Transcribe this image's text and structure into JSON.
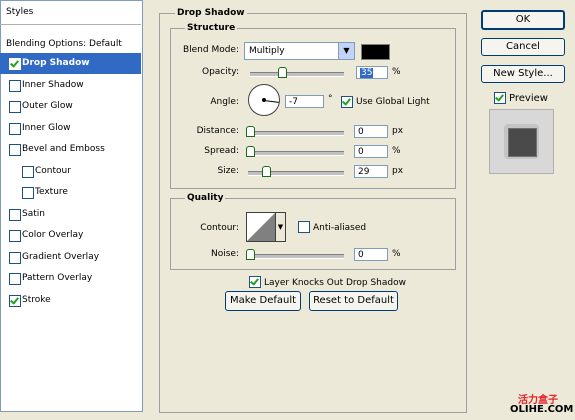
{
  "styles_panel": {
    "header": "Styles",
    "blending_options": "Blending Options: Default",
    "items": [
      {
        "label": "Drop Shadow",
        "checked": true
      },
      {
        "label": "Inner Shadow",
        "checked": false
      },
      {
        "label": "Outer Glow",
        "checked": false
      },
      {
        "label": "Inner Glow",
        "checked": false
      },
      {
        "label": "Bevel and Emboss",
        "checked": false
      },
      {
        "label": "Contour",
        "checked": false
      },
      {
        "label": "Texture",
        "checked": false
      },
      {
        "label": "Satin",
        "checked": false
      },
      {
        "label": "Color Overlay",
        "checked": false
      },
      {
        "label": "Gradient Overlay",
        "checked": false
      },
      {
        "label": "Pattern Overlay",
        "checked": false
      },
      {
        "label": "Stroke",
        "checked": true
      }
    ]
  },
  "drop_shadow": {
    "title": "Drop Shadow",
    "structure": {
      "title": "Structure",
      "blend_mode_label": "Blend Mode:",
      "blend_mode_value": "Multiply",
      "shadow_color": "#000000",
      "opacity_label": "Opacity:",
      "opacity_value": "35",
      "opacity_unit": "%",
      "angle_label": "Angle:",
      "angle_value": "-7",
      "angle_unit": "°",
      "use_global_light": "Use Global Light",
      "distance_label": "Distance:",
      "distance_value": "0",
      "distance_unit": "px",
      "spread_label": "Spread:",
      "spread_value": "0",
      "spread_unit": "%",
      "size_label": "Size:",
      "size_value": "29",
      "size_unit": "px"
    },
    "quality": {
      "title": "Quality",
      "contour_label": "Contour:",
      "anti_aliased": "Anti-aliased",
      "noise_label": "Noise:",
      "noise_value": "0",
      "noise_unit": "%"
    },
    "layer_knocks_out": "Layer Knocks Out Drop Shadow",
    "make_default": "Make Default",
    "reset_to_default": "Reset to Default"
  },
  "buttons": {
    "ok": "OK",
    "cancel": "Cancel",
    "new_style": "New Style...",
    "preview": "Preview"
  },
  "watermark": {
    "line1": "活力盒子",
    "line2": "OLIHE.COM"
  }
}
